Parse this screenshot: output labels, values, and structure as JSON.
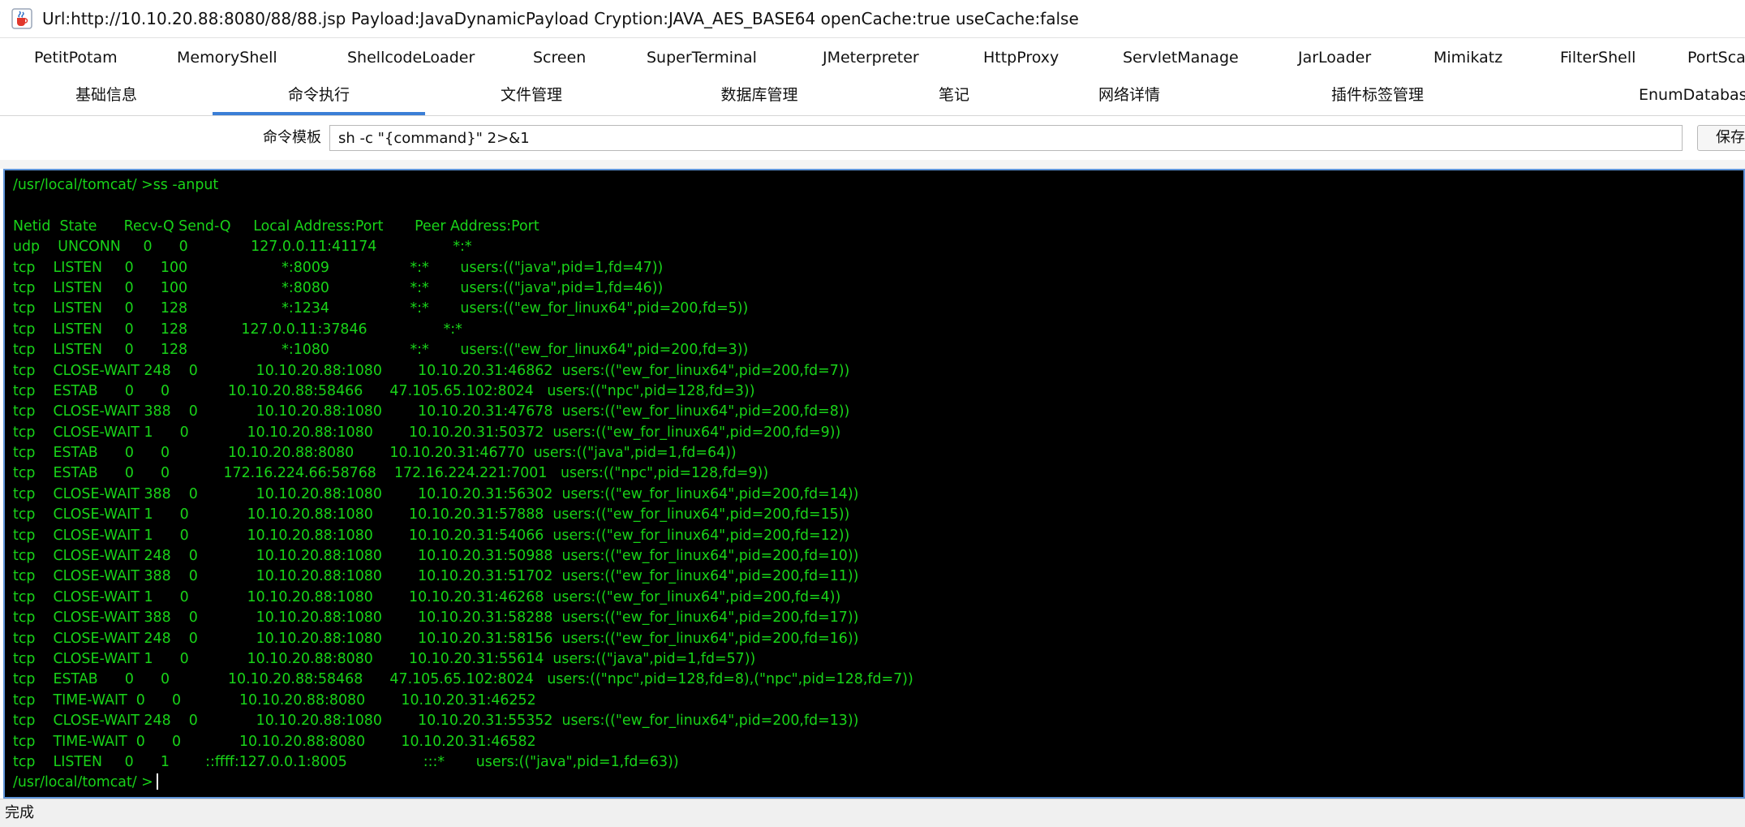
{
  "window": {
    "title": "Url:http://10.10.20.88:8080/88/88.jsp Payload:JavaDynamicPayload Cryption:JAVA_AES_BASE64 openCache:true useCache:false",
    "icon": "java-cup-icon"
  },
  "plugin_tabs": [
    {
      "label": "PetitPotam"
    },
    {
      "label": "MemoryShell"
    },
    {
      "label": "ShellcodeLoader"
    },
    {
      "label": "Screen"
    },
    {
      "label": "SuperTerminal"
    },
    {
      "label": "JMeterpreter"
    },
    {
      "label": "HttpProxy"
    },
    {
      "label": "ServletManage"
    },
    {
      "label": "JarLoader"
    },
    {
      "label": "Mimikatz"
    },
    {
      "label": "FilterShell"
    },
    {
      "label": "PortScan"
    }
  ],
  "main_tabs": [
    {
      "label": "基础信息"
    },
    {
      "label": "命令执行",
      "active": true
    },
    {
      "label": "文件管理"
    },
    {
      "label": "数据库管理"
    },
    {
      "label": "笔记"
    },
    {
      "label": "网络详情"
    },
    {
      "label": "插件标签管理"
    },
    {
      "label": "EnumDatabase"
    }
  ],
  "command_template": {
    "label": "命令模板",
    "value": "sh -c \"{command}\" 2>&1",
    "save_label": "保存"
  },
  "terminal": {
    "text_color": "#19d319",
    "background": "#000000",
    "lines": [
      "/usr/local/tomcat/ >ss -anput",
      "",
      "Netid  State      Recv-Q Send-Q     Local Address:Port       Peer Address:Port",
      "udp    UNCONN     0      0              127.0.0.11:41174                 *:*",
      "tcp    LISTEN     0      100                     *:8009                  *:*       users:((\"java\",pid=1,fd=47))",
      "tcp    LISTEN     0      100                     *:8080                  *:*       users:((\"java\",pid=1,fd=46))",
      "tcp    LISTEN     0      128                     *:1234                  *:*       users:((\"ew_for_linux64\",pid=200,fd=5))",
      "tcp    LISTEN     0      128            127.0.0.11:37846                 *:*",
      "tcp    LISTEN     0      128                     *:1080                  *:*       users:((\"ew_for_linux64\",pid=200,fd=3))",
      "tcp    CLOSE-WAIT 248    0             10.10.20.88:1080        10.10.20.31:46862  users:((\"ew_for_linux64\",pid=200,fd=7))",
      "tcp    ESTAB      0      0             10.10.20.88:58466      47.105.65.102:8024   users:((\"npc\",pid=128,fd=3))",
      "tcp    CLOSE-WAIT 388    0             10.10.20.88:1080        10.10.20.31:47678  users:((\"ew_for_linux64\",pid=200,fd=8))",
      "tcp    CLOSE-WAIT 1      0             10.10.20.88:1080        10.10.20.31:50372  users:((\"ew_for_linux64\",pid=200,fd=9))",
      "tcp    ESTAB      0      0             10.10.20.88:8080        10.10.20.31:46770  users:((\"java\",pid=1,fd=64))",
      "tcp    ESTAB      0      0            172.16.224.66:58768    172.16.224.221:7001   users:((\"npc\",pid=128,fd=9))",
      "tcp    CLOSE-WAIT 388    0             10.10.20.88:1080        10.10.20.31:56302  users:((\"ew_for_linux64\",pid=200,fd=14))",
      "tcp    CLOSE-WAIT 1      0             10.10.20.88:1080        10.10.20.31:57888  users:((\"ew_for_linux64\",pid=200,fd=15))",
      "tcp    CLOSE-WAIT 1      0             10.10.20.88:1080        10.10.20.31:54066  users:((\"ew_for_linux64\",pid=200,fd=12))",
      "tcp    CLOSE-WAIT 248    0             10.10.20.88:1080        10.10.20.31:50988  users:((\"ew_for_linux64\",pid=200,fd=10))",
      "tcp    CLOSE-WAIT 388    0             10.10.20.88:1080        10.10.20.31:51702  users:((\"ew_for_linux64\",pid=200,fd=11))",
      "tcp    CLOSE-WAIT 1      0             10.10.20.88:1080        10.10.20.31:46268  users:((\"ew_for_linux64\",pid=200,fd=4))",
      "tcp    CLOSE-WAIT 388    0             10.10.20.88:1080        10.10.20.31:58288  users:((\"ew_for_linux64\",pid=200,fd=17))",
      "tcp    CLOSE-WAIT 248    0             10.10.20.88:1080        10.10.20.31:58156  users:((\"ew_for_linux64\",pid=200,fd=16))",
      "tcp    CLOSE-WAIT 1      0             10.10.20.88:8080        10.10.20.31:55614  users:((\"java\",pid=1,fd=57))",
      "tcp    ESTAB      0      0             10.10.20.88:58468      47.105.65.102:8024   users:((\"npc\",pid=128,fd=8),(\"npc\",pid=128,fd=7))",
      "tcp    TIME-WAIT  0      0             10.10.20.88:8080        10.10.20.31:46252",
      "tcp    CLOSE-WAIT 248    0             10.10.20.88:1080        10.10.20.31:55352  users:((\"ew_for_linux64\",pid=200,fd=13))",
      "tcp    TIME-WAIT  0      0             10.10.20.88:8080        10.10.20.31:46582",
      "tcp    LISTEN     0      1        ::ffff:127.0.0.1:8005                 :::*       users:((\"java\",pid=1,fd=63))",
      "/usr/local/tomcat/ >"
    ]
  },
  "status": {
    "text": "完成"
  }
}
